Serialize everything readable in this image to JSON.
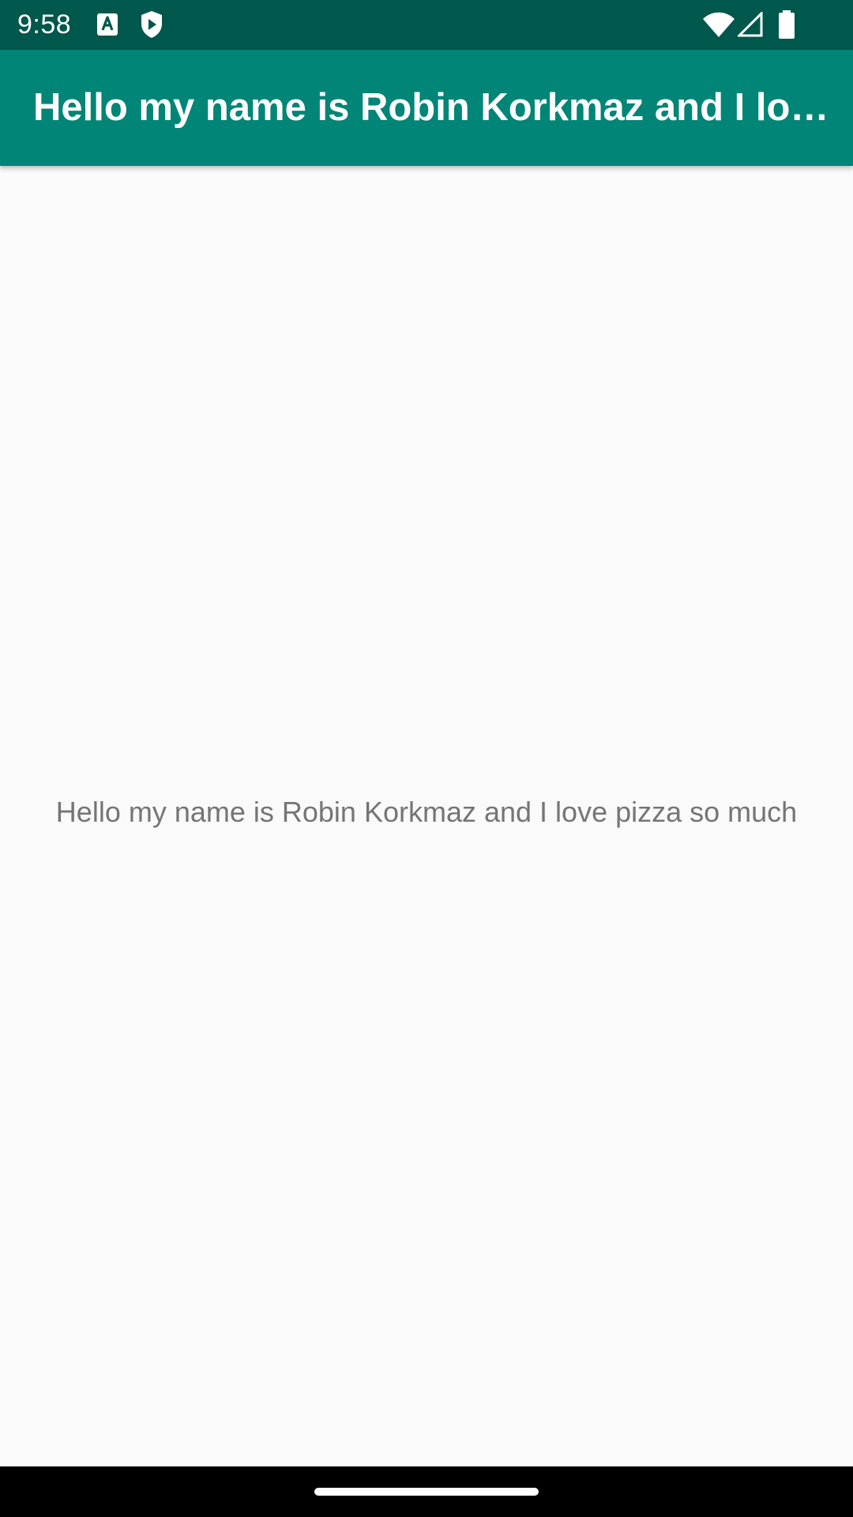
{
  "status_bar": {
    "time": "9:58",
    "left_icons": [
      "accessibility-a-icon",
      "play-protect-icon"
    ],
    "right_icons": [
      "wifi-icon",
      "cell-signal-icon",
      "battery-icon"
    ],
    "background": "#00574b"
  },
  "app_bar": {
    "title": "Hello my name is Robin Korkmaz and I love pizza so much",
    "background": "#008577"
  },
  "main": {
    "text": "Hello my name is Robin Korkmaz and I love pizza so much"
  },
  "nav_bar": {
    "background": "#000000"
  }
}
